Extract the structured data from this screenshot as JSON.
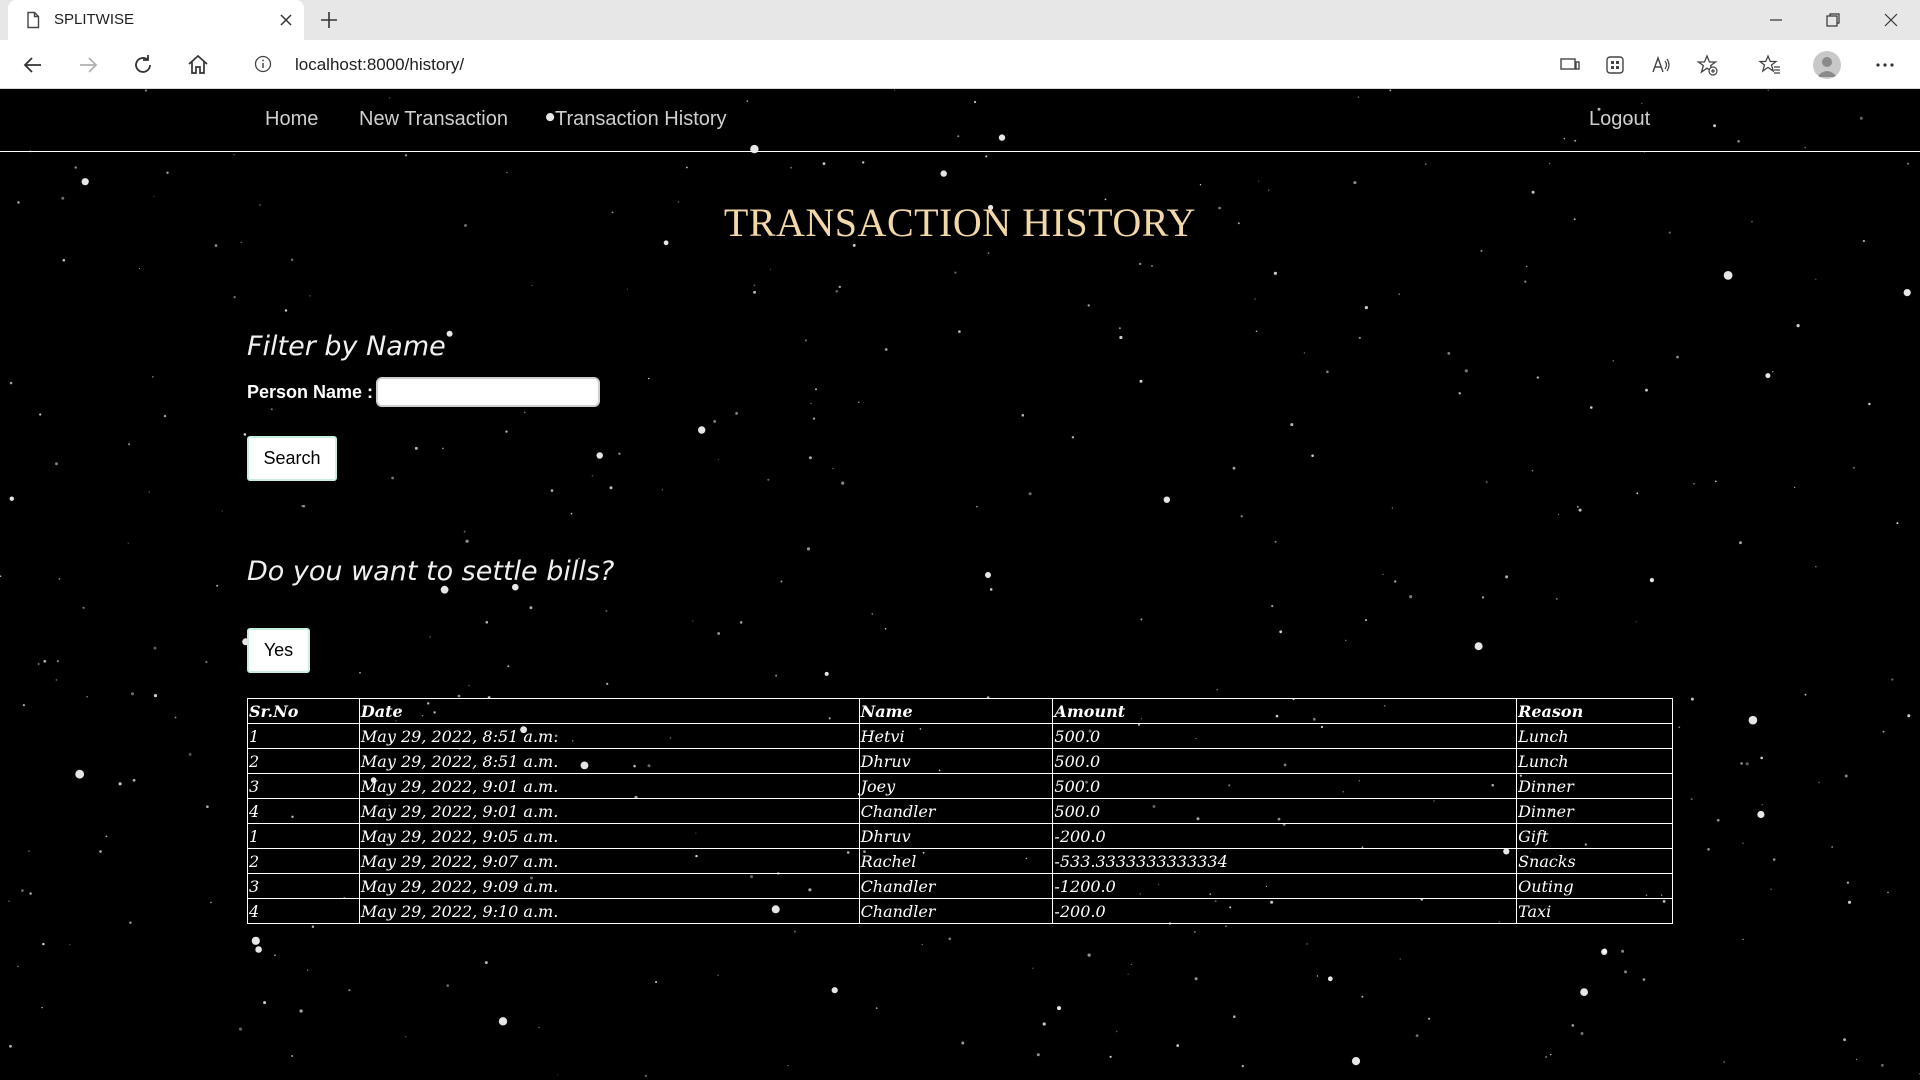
{
  "browser": {
    "tab_title": "SPLITWISE",
    "url": "localhost:8000/history/"
  },
  "nav": {
    "home": "Home",
    "new_transaction": "New Transaction",
    "transaction_history": "Transaction History",
    "logout": "Logout"
  },
  "page": {
    "title": "TRANSACTION HISTORY",
    "filter_heading": "Filter by Name",
    "person_label": "Person Name :",
    "person_value": "",
    "search_button": "Search",
    "settle_heading": "Do you want to settle bills?",
    "yes_button": "Yes"
  },
  "table": {
    "headers": [
      "Sr.No",
      "Date",
      "Name",
      "Amount",
      "Reason"
    ],
    "rows": [
      [
        "1",
        "May 29, 2022, 8:51 a.m.",
        "Hetvi",
        "500.0",
        "Lunch"
      ],
      [
        "2",
        "May 29, 2022, 8:51 a.m.",
        "Dhruv",
        "500.0",
        "Lunch"
      ],
      [
        "3",
        "May 29, 2022, 9:01 a.m.",
        "Joey",
        "500.0",
        "Dinner"
      ],
      [
        "4",
        "May 29, 2022, 9:01 a.m.",
        "Chandler",
        "500.0",
        "Dinner"
      ],
      [
        "1",
        "May 29, 2022, 9:05 a.m.",
        "Dhruv",
        "-200.0",
        "Gift"
      ],
      [
        "2",
        "May 29, 2022, 9:07 a.m.",
        "Rachel",
        "-533.3333333333334",
        "Snacks"
      ],
      [
        "3",
        "May 29, 2022, 9:09 a.m.",
        "Chandler",
        "-1200.0",
        "Outing"
      ],
      [
        "4",
        "May 29, 2022, 9:10 a.m.",
        "Chandler",
        "-200.0",
        "Taxi"
      ]
    ]
  },
  "colors": {
    "background": "#000000",
    "title": "#f2d7a8",
    "nav_text": "#cfcfcf",
    "table_border": "#ffffff"
  }
}
